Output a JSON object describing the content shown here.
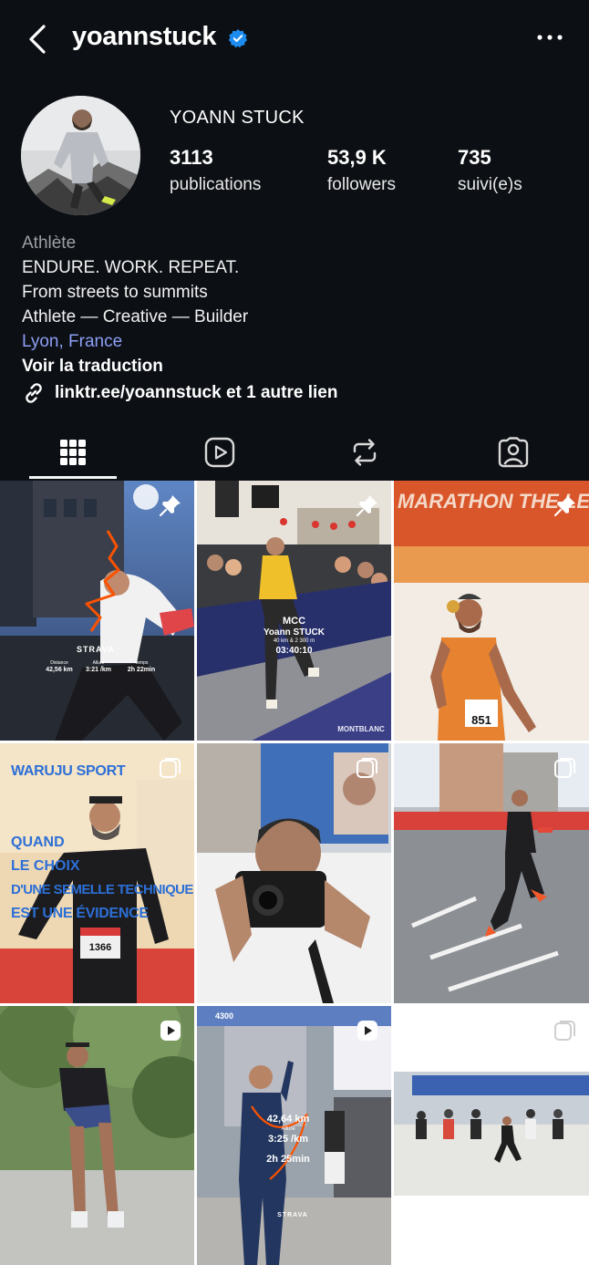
{
  "header": {
    "username": "yoannstuck"
  },
  "profile": {
    "full_name": "YOANN STUCK",
    "stats": {
      "posts_count": "3113",
      "posts_label": "publications",
      "followers_count": "53,9 K",
      "followers_label": "followers",
      "following_count": "735",
      "following_label": "suivi(e)s"
    },
    "bio": {
      "category": "Athlète",
      "line1": "ENDURE. WORK. REPEAT.",
      "line2": "From streets to summits",
      "line3": "Athlete — Creative — Builder",
      "location": "Lyon, France",
      "translate_label": "Voir la traduction",
      "link_text": "linktr.ee/yoannstuck et 1 autre lien"
    }
  },
  "tabs": [
    {
      "icon": "grid-icon",
      "active": true
    },
    {
      "icon": "reels-icon",
      "active": false
    },
    {
      "icon": "reposts-icon",
      "active": false
    },
    {
      "icon": "tagged-icon",
      "active": false
    }
  ],
  "posts": {
    "post1": {
      "badge": "pin-icon",
      "strava_logo": "STRAVA",
      "distance_label": "Distance",
      "distance_value": "42,56 km",
      "pace_label": "Allure",
      "pace_value": "3:21 /km",
      "time_label": "Temps",
      "time_value": "2h 22min"
    },
    "post2": {
      "badge": "pin-icon",
      "race": "MCC",
      "name": "Yoann STUCK",
      "details": "40 km & 2 300 m",
      "time": "03:40:10",
      "bib_text": "MCC",
      "banner_text": "MONTBLANC"
    },
    "post3": {
      "badge": "pin-icon",
      "banner": "MARATHON THE LEGEND",
      "bib": "851"
    },
    "post4": {
      "badge": "carousel-icon",
      "brand": "WARUJU SPORT",
      "headline1": "QUAND",
      "headline2": "LE CHOIX",
      "headline3": "D'UNE SEMELLE TECHNIQUE",
      "headline4": "EST UNE ÉVIDENCE",
      "bib": "1366"
    },
    "post5": {
      "badge": "carousel-icon"
    },
    "post6": {
      "badge": "carousel-icon"
    },
    "post7": {
      "badge": "reel-icon"
    },
    "post8": {
      "badge": "reel-icon",
      "distance": "42,64 km",
      "pace_label": "Allure",
      "pace": "3:25 /km",
      "time": "2h 25min",
      "strava_logo": "STRAVA",
      "billboard": "4300"
    },
    "post9": {
      "badge": "carousel-icon"
    }
  },
  "colors": {
    "background": "#0c0f14",
    "verified_blue": "#1d8cf0",
    "location_link": "#8e9ff5",
    "strava_orange": "#fc5200"
  }
}
